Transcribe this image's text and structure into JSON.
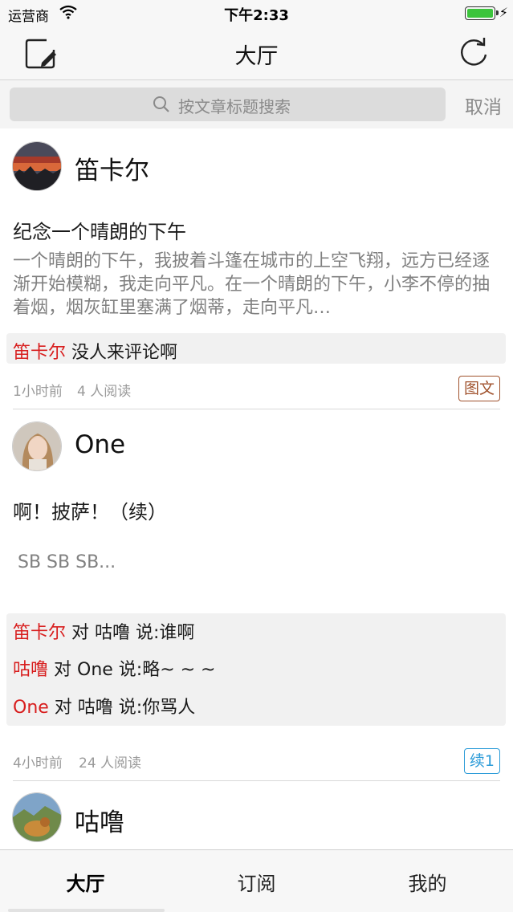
{
  "status_bar": {
    "carrier": "运营商",
    "time": "下午2:33"
  },
  "nav": {
    "title": "大厅",
    "left_icon": "compose-icon",
    "right_icon": "refresh-icon"
  },
  "search": {
    "placeholder": "按文章标题搜索",
    "cancel_label": "取消"
  },
  "posts": [
    {
      "author": "笛卡尔",
      "title": "纪念一个晴朗的下午",
      "summary": " 一个晴朗的下午，我披着斗篷在城市的上空飞翔，远方已经逐渐开始模糊，我走向平凡。在一个晴朗的下午，小李不停的抽着烟，烟灰缸里塞满了烟蒂，走向平凡…",
      "comments": [
        {
          "from": "笛卡尔",
          "text": " 没人来评论啊"
        }
      ],
      "time": "1小时前",
      "reads": "4 人阅读",
      "tag": "图文"
    },
    {
      "author": "One",
      "title": "啊！披萨！（续）",
      "summary": "SB SB SB...",
      "comments": [
        {
          "from": "笛卡尔",
          "text": " 对 咕噜 说:谁啊"
        },
        {
          "from": "咕噜",
          "text": " 对 One 说:略~ ~ ~"
        },
        {
          "from": "One",
          "text": " 对 咕噜 说:你骂人"
        }
      ],
      "time": "4小时前",
      "reads": "24 人阅读",
      "tag": "续1"
    },
    {
      "author": "咕噜"
    }
  ],
  "tabs": [
    {
      "label": "大厅",
      "active": true
    },
    {
      "label": "订阅",
      "active": false
    },
    {
      "label": "我的",
      "active": false
    }
  ],
  "colors": {
    "accent_red": "#d81e1e",
    "tag_brown": "#a0522d",
    "tag_blue": "#2b9bd8",
    "battery_green": "#3cc43c"
  }
}
